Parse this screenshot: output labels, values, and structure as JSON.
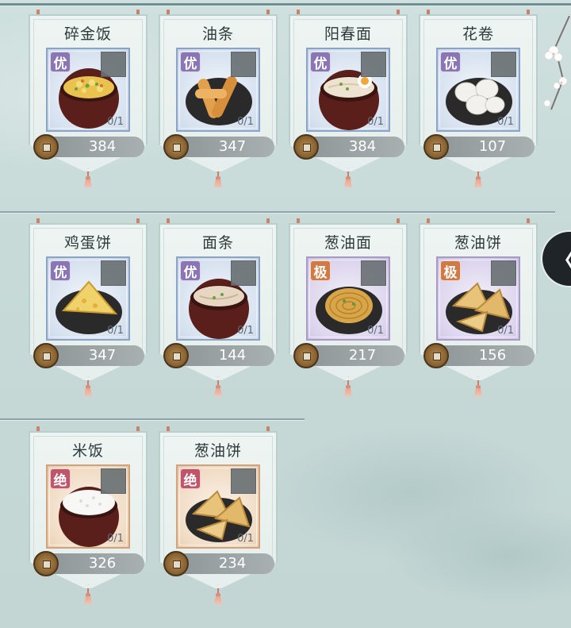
{
  "menu": {
    "rows": [
      {
        "items": [
          {
            "name": "碎金饭",
            "grade": "优",
            "count": "0/1",
            "price": "384",
            "dish": "fried-rice",
            "frame": "blue"
          },
          {
            "name": "油条",
            "grade": "优",
            "count": "0/1",
            "price": "347",
            "dish": "youtiao",
            "frame": "blue"
          },
          {
            "name": "阳春面",
            "grade": "优",
            "count": "0/1",
            "price": "384",
            "dish": "noodle-soup",
            "frame": "blue"
          },
          {
            "name": "花卷",
            "grade": "优",
            "count": "0/1",
            "price": "107",
            "dish": "steamed-rolls",
            "frame": "blue"
          }
        ]
      },
      {
        "items": [
          {
            "name": "鸡蛋饼",
            "grade": "优",
            "count": "0/1",
            "price": "347",
            "dish": "egg-pancake",
            "frame": "blue"
          },
          {
            "name": "面条",
            "grade": "优",
            "count": "0/1",
            "price": "144",
            "dish": "noodle-bowl",
            "frame": "blue"
          },
          {
            "name": "葱油面",
            "grade": "极",
            "count": "0/1",
            "price": "217",
            "dish": "scallion-noodles",
            "frame": "purple"
          },
          {
            "name": "葱油饼",
            "grade": "极",
            "count": "0/1",
            "price": "156",
            "dish": "scallion-pancake",
            "frame": "purple"
          }
        ]
      },
      {
        "items": [
          {
            "name": "米饭",
            "grade": "绝",
            "count": "0/1",
            "price": "326",
            "dish": "rice-bowl",
            "frame": "orange"
          },
          {
            "name": "葱油饼",
            "grade": "绝",
            "count": "0/1",
            "price": "234",
            "dish": "scallion-pancake",
            "frame": "orange"
          }
        ]
      }
    ]
  },
  "colors": {
    "grade_you": "#8a76b4",
    "grade_ji": "#d07a45",
    "grade_jue": "#c0556a"
  },
  "back_tab": {
    "glyph": "〈",
    "icon": "chevron-left-icon"
  }
}
